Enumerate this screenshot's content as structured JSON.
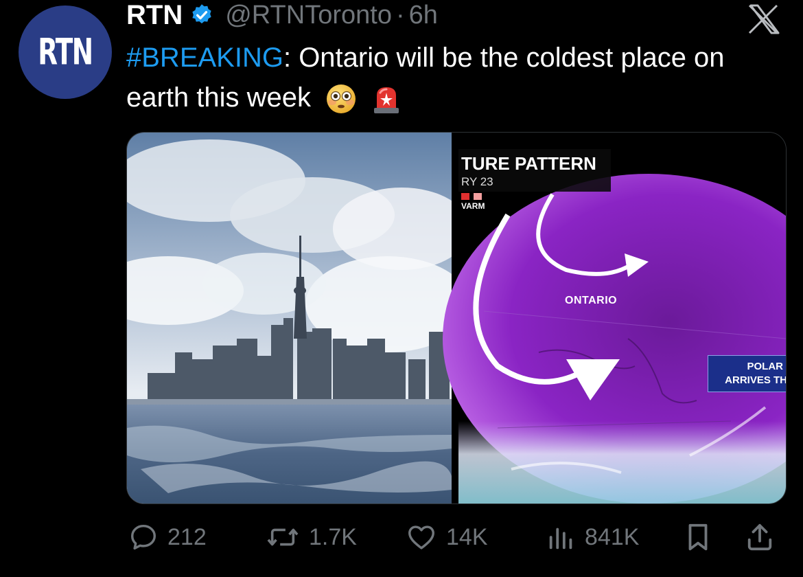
{
  "account": {
    "avatar_text": "RTN",
    "name": "RTN",
    "handle": "@RTNToronto",
    "separator": "·",
    "time": "6h",
    "verified_icon": "verified-badge-icon",
    "close_icon": "x-logo-icon"
  },
  "tweet": {
    "hashtag": "#BREAKING",
    "text": ": Ontario will be the coldest place on earth this week",
    "emojis": [
      "flushed-face-icon",
      "police-light-icon"
    ]
  },
  "media": {
    "map": {
      "title": "TURE PATTERN",
      "date": "RY 23",
      "legend_label": "VARM",
      "region_label": "ONTARIO",
      "callout_line1": "POLAR",
      "callout_line2": "ARRIVES TH"
    }
  },
  "actions": {
    "replies": "212",
    "reposts": "1.7K",
    "likes": "14K",
    "views": "841K"
  },
  "colors": {
    "background": "#000000",
    "accent": "#1d9bf0",
    "secondary_text": "#71767b",
    "avatar_bg": "#2a3d86"
  }
}
